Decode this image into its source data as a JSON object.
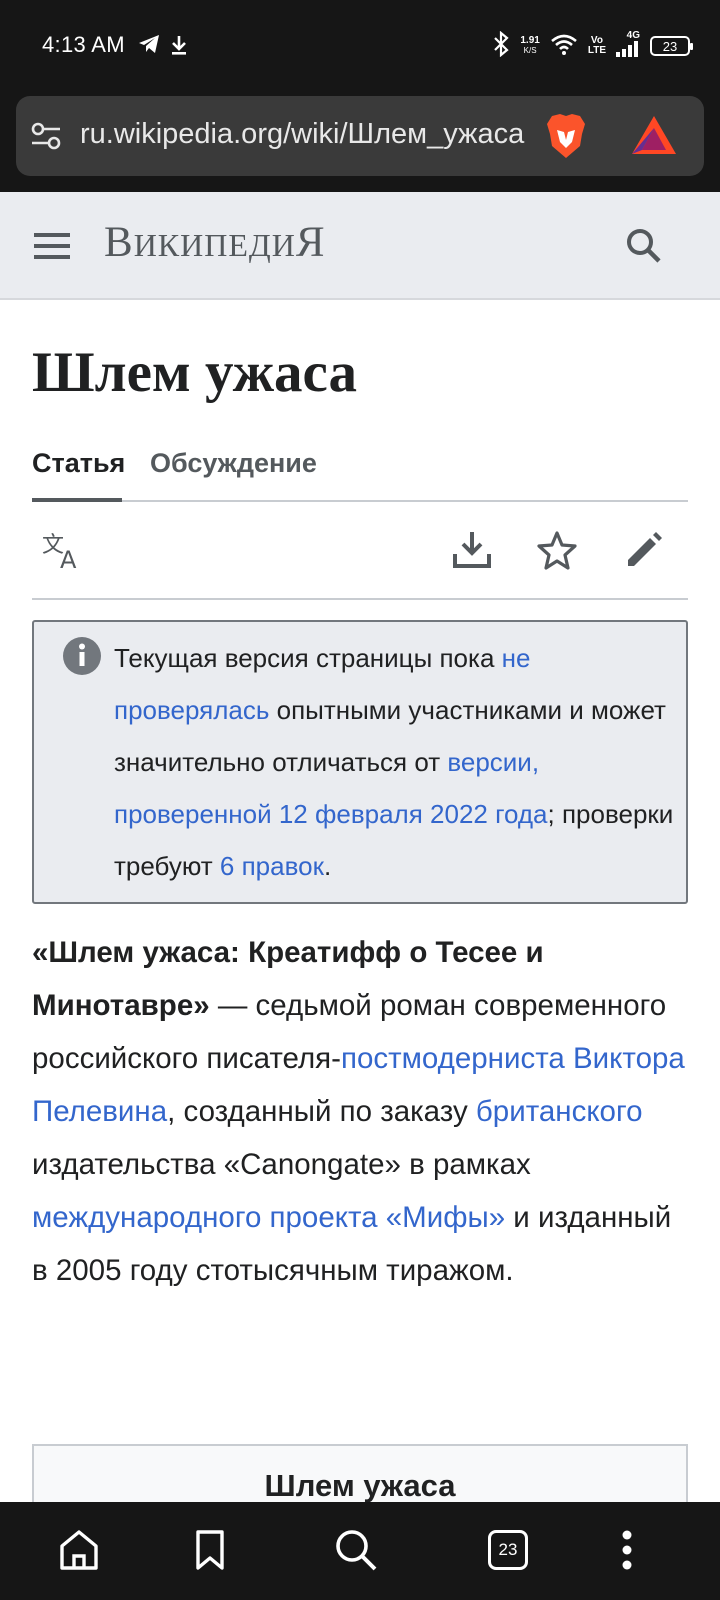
{
  "status_bar": {
    "time": "4:13 AM",
    "net_speed_value": "1.91",
    "net_speed_unit": "K/S",
    "volte_top": "Vo",
    "volte_bottom": "LTE",
    "network": "4G",
    "battery": "23",
    "icons": [
      "telegram-icon",
      "download-icon",
      "bluetooth-icon",
      "wifi-icon",
      "signal-icon",
      "battery-icon"
    ]
  },
  "browser": {
    "url": "ru.wikipedia.org/wiki/Шлем_ужаса",
    "icons": [
      "site-settings-icon",
      "brave-shields-icon",
      "brave-rewards-icon"
    ]
  },
  "wiki_header": {
    "logo_big_1": "В",
    "logo_small": "ИКИПЕДИ",
    "logo_big_2": "Я"
  },
  "page": {
    "title": "Шлем ужаса",
    "tabs": [
      {
        "label": "Статья",
        "active": true
      },
      {
        "label": "Обсуждение",
        "active": false
      }
    ],
    "actions": [
      "language-icon",
      "download-icon",
      "watch-star-icon",
      "edit-pencil-icon"
    ]
  },
  "notice": {
    "t1": "Текущая версия страницы пока ",
    "l1": "не проверялась",
    "t2": " опытными участниками и может значительно отличаться от ",
    "l2": "версии, проверенной 12 февраля 2022 года",
    "t3": "; проверки требуют ",
    "l3": "6 правок",
    "t4": "."
  },
  "lead": {
    "bold": "«Шлем ужаса: Креатифф о Тесее и Минотавре»",
    "t1": " — седьмой роман современного российского писателя-",
    "l1": "постмодерниста",
    "t2": " ",
    "l2": "Виктора Пелевина",
    "t3": ", созданный по заказу ",
    "l3": "британского",
    "t4": " издательства «Canongate» в рамках ",
    "l4": "международного проекта «Мифы»",
    "t5": " и изданный в 2005 году стотысячным тиражом."
  },
  "infobox": {
    "title": "Шлем ужаса"
  },
  "bottom_nav": {
    "tabs_count": "23",
    "icons": [
      "home-icon",
      "bookmark-icon",
      "search-icon",
      "tabs-icon",
      "more-menu-icon"
    ]
  }
}
